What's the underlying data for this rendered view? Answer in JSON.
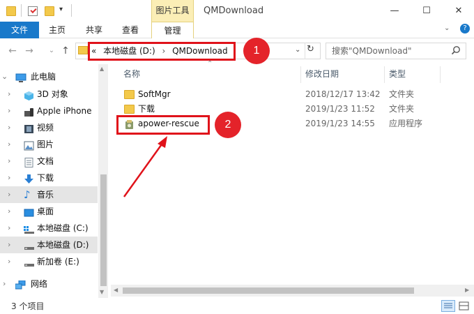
{
  "window": {
    "title": "QMDownload",
    "context_tab_header": "图片工具",
    "controls": [
      "—",
      "☐",
      "✕"
    ]
  },
  "ribbon": {
    "tabs": [
      {
        "label": "文件"
      },
      {
        "label": "主页"
      },
      {
        "label": "共享"
      },
      {
        "label": "查看"
      },
      {
        "label": "管理"
      }
    ]
  },
  "address": {
    "prefix": "«",
    "segments": [
      "本地磁盘 (D:)",
      "QMDownload"
    ],
    "separator": "›"
  },
  "search": {
    "placeholder": "搜索\"QMDownload\""
  },
  "annotations": {
    "badge1": "1",
    "badge2": "2",
    "color": "#e4232a"
  },
  "nav": {
    "items": [
      {
        "label": "此电脑",
        "icon": "pc-icon"
      },
      {
        "label": "3D 对象",
        "icon": "3d-objects-icon"
      },
      {
        "label": "Apple iPhone",
        "icon": "iphone-icon"
      },
      {
        "label": "视频",
        "icon": "video-icon"
      },
      {
        "label": "图片",
        "icon": "picture-icon"
      },
      {
        "label": "文档",
        "icon": "document-icon"
      },
      {
        "label": "下载",
        "icon": "download-icon"
      },
      {
        "label": "音乐",
        "icon": "music-icon"
      },
      {
        "label": "桌面",
        "icon": "desktop-icon"
      },
      {
        "label": "本地磁盘 (C:)",
        "icon": "drive-c-icon"
      },
      {
        "label": "本地磁盘 (D:)",
        "icon": "drive-icon"
      },
      {
        "label": "新加卷 (E:)",
        "icon": "drive-icon"
      },
      {
        "label": "网络",
        "icon": "network-icon"
      }
    ]
  },
  "columns": {
    "name": "名称",
    "date": "修改日期",
    "type": "类型"
  },
  "files": [
    {
      "name": "SoftMgr",
      "date": "2018/12/17 13:42",
      "type": "文件夹",
      "icon": "folder-icon"
    },
    {
      "name": "下载",
      "date": "2019/1/23 11:52",
      "type": "文件夹",
      "icon": "folder-icon"
    },
    {
      "name": "apower-rescue",
      "date": "2019/1/23 14:55",
      "type": "应用程序",
      "icon": "installer-icon"
    }
  ],
  "status": {
    "item_count": "3 个项目"
  }
}
